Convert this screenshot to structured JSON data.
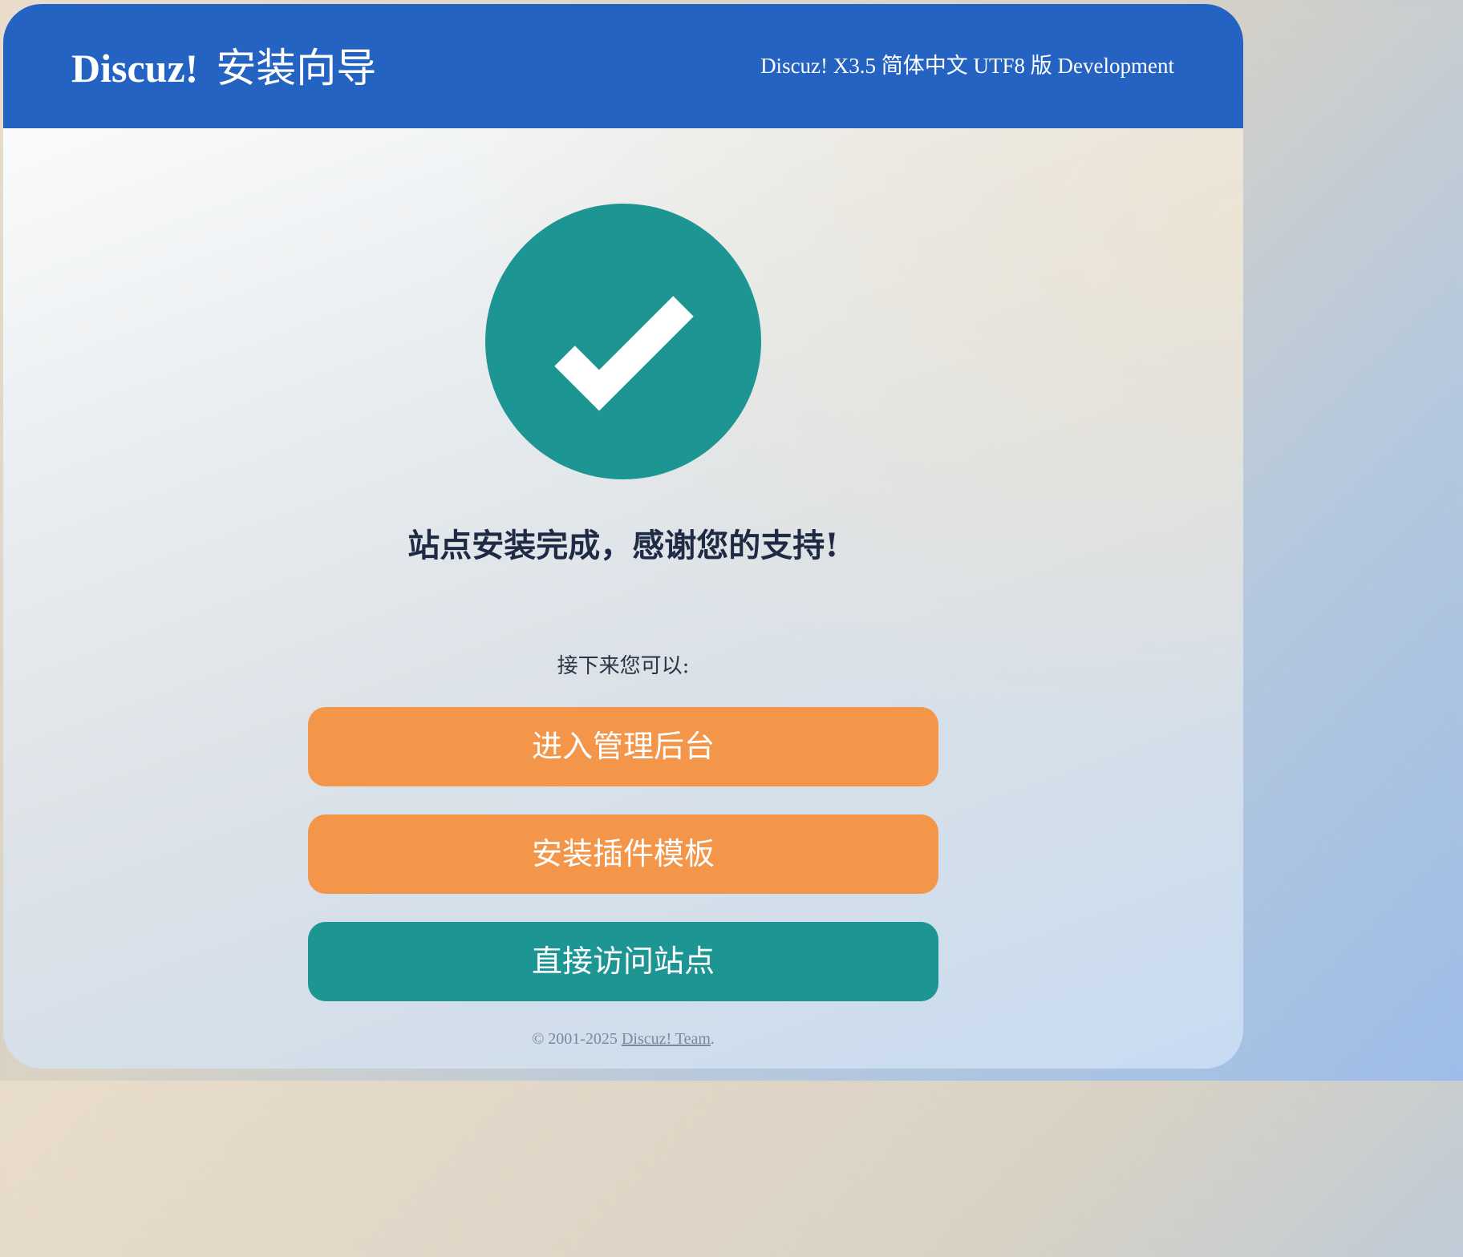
{
  "header": {
    "brand_name": "Discuz!",
    "brand_subtitle": "安装向导",
    "version": "Discuz! X3.5 简体中文 UTF8 版 Development",
    "background_color": "#2563c2"
  },
  "status": {
    "icon": "check-circle-icon",
    "icon_color": "#1d9593",
    "headline": "站点安装完成，感谢您的支持!"
  },
  "next_steps": {
    "intro": "接下来您可以:",
    "buttons": [
      {
        "label": "进入管理后台",
        "color": "#f39649"
      },
      {
        "label": "安装插件模板",
        "color": "#f39649"
      },
      {
        "label": "直接访问站点",
        "color": "#1d9593"
      }
    ]
  },
  "footer": {
    "copyright": "© 2001-2025",
    "team_link": "Discuz! Team",
    "suffix": "."
  }
}
